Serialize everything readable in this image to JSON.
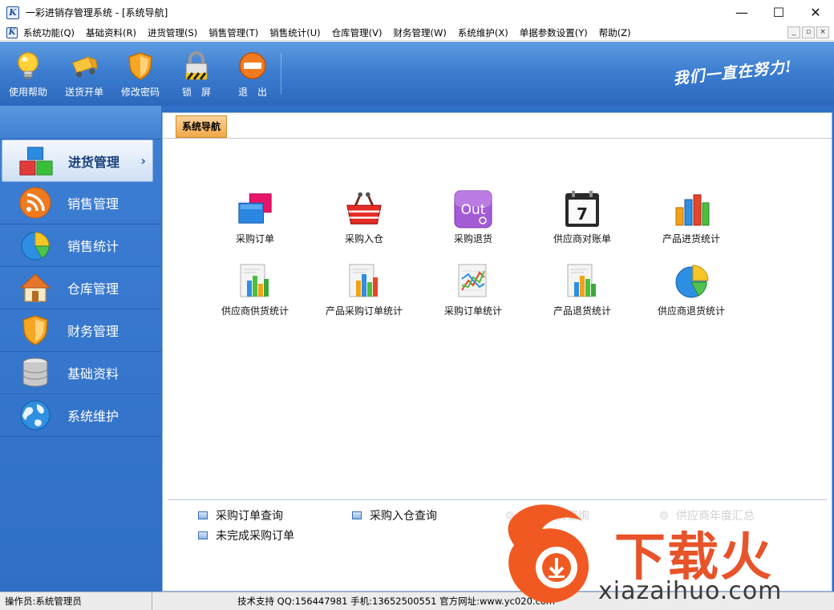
{
  "window": {
    "logo_glyph": "K",
    "title": "一彩进销存管理系统 - [系统导航]",
    "minimize": "—",
    "maximize": "☐",
    "close": "✕"
  },
  "menubar": {
    "items": [
      "系统功能(Q)",
      "基础资料(R)",
      "进货管理(S)",
      "销售管理(T)",
      "销售统计(U)",
      "仓库管理(V)",
      "财务管理(W)",
      "系统维护(X)",
      "单据参数设置(Y)",
      "帮助(Z)"
    ],
    "mdi_minimize": "_",
    "mdi_restore": "▫",
    "mdi_close": "×"
  },
  "toolbar": {
    "items": [
      {
        "label": "使用帮助",
        "icon": "lightbulb-icon"
      },
      {
        "label": "送货开单",
        "icon": "truck-icon"
      },
      {
        "label": "修改密码",
        "icon": "shield-icon"
      },
      {
        "label": "锁　屏",
        "icon": "padlock-icon"
      },
      {
        "label": "退　出",
        "icon": "exit-icon"
      }
    ],
    "slogan": "我们一直在努力!"
  },
  "leftnav": {
    "items": [
      {
        "label": "进货管理",
        "icon": "blocks-icon",
        "active": true
      },
      {
        "label": "销售管理",
        "icon": "rss-icon"
      },
      {
        "label": "销售统计",
        "icon": "pie-chart-icon"
      },
      {
        "label": "仓库管理",
        "icon": "house-icon"
      },
      {
        "label": "财务管理",
        "icon": "shield-icon"
      },
      {
        "label": "基础资料",
        "icon": "database-icon"
      },
      {
        "label": "系统维护",
        "icon": "globe-icon"
      }
    ],
    "chevron": "›"
  },
  "main": {
    "tab_label": "系统导航",
    "grid": [
      {
        "label": "采购订单",
        "icon": "purchase-order-icon"
      },
      {
        "label": "采购入仓",
        "icon": "basket-icon"
      },
      {
        "label": "采购退货",
        "icon": "out-icon",
        "icon_text": "Out"
      },
      {
        "label": "供应商对账单",
        "icon": "calendar-icon",
        "icon_text": "7"
      },
      {
        "label": "产品进货统计",
        "icon": "bar-chart-icon"
      },
      {
        "label": "供应商供货统计",
        "icon": "report-chart-icon"
      },
      {
        "label": "产品采购订单统计",
        "icon": "report-chart-icon"
      },
      {
        "label": "采购订单统计",
        "icon": "line-chart-icon"
      },
      {
        "label": "产品退货统计",
        "icon": "report-chart-icon"
      },
      {
        "label": "供应商退货统计",
        "icon": "pie-chart-icon"
      }
    ],
    "quick_links": [
      {
        "label": "采购订单查询"
      },
      {
        "label": "采购入仓查询"
      },
      {
        "label": "采购退货查询",
        "faded": true
      },
      {
        "label": "供应商年度汇总",
        "faded": true
      },
      {
        "label": "未完成采购订单"
      }
    ]
  },
  "statusbar": {
    "operator": "操作员:系统管理员",
    "support": "技术支持 QQ:156447981 手机:13652500551 官方网址:www.yc020.com"
  },
  "watermark": {
    "text": "下载火",
    "sub": "xiazaihuo.com"
  },
  "colors": {
    "toolbar_blue": "#3d7ed1",
    "nav_blue": "#2f6fc6",
    "tab_orange": "#f2a847",
    "watermark_orange": "#e8532a"
  }
}
